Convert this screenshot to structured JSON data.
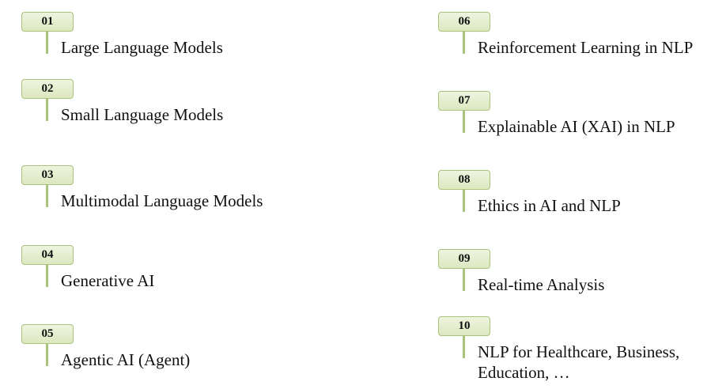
{
  "topics": [
    {
      "number": "01",
      "label": "Large Language Models"
    },
    {
      "number": "02",
      "label": "Small Language Models"
    },
    {
      "number": "03",
      "label": "Multimodal Language Models"
    },
    {
      "number": "04",
      "label": "Generative AI"
    },
    {
      "number": "05",
      "label": "Agentic AI (Agent)"
    },
    {
      "number": "06",
      "label": "Reinforcement Learning in NLP"
    },
    {
      "number": "07",
      "label": "Explainable AI (XAI) in NLP"
    },
    {
      "number": "08",
      "label": "Ethics in AI and NLP"
    },
    {
      "number": "09",
      "label": "Real-time Analysis"
    },
    {
      "number": "10",
      "label_line1": "NLP for Healthcare, Business,",
      "label_line2": "Education, …"
    }
  ],
  "colors": {
    "badge_fill_top": "#eef4df",
    "badge_fill_bottom": "#dce8c0",
    "badge_border": "#a9c27c",
    "text": "#111111"
  }
}
